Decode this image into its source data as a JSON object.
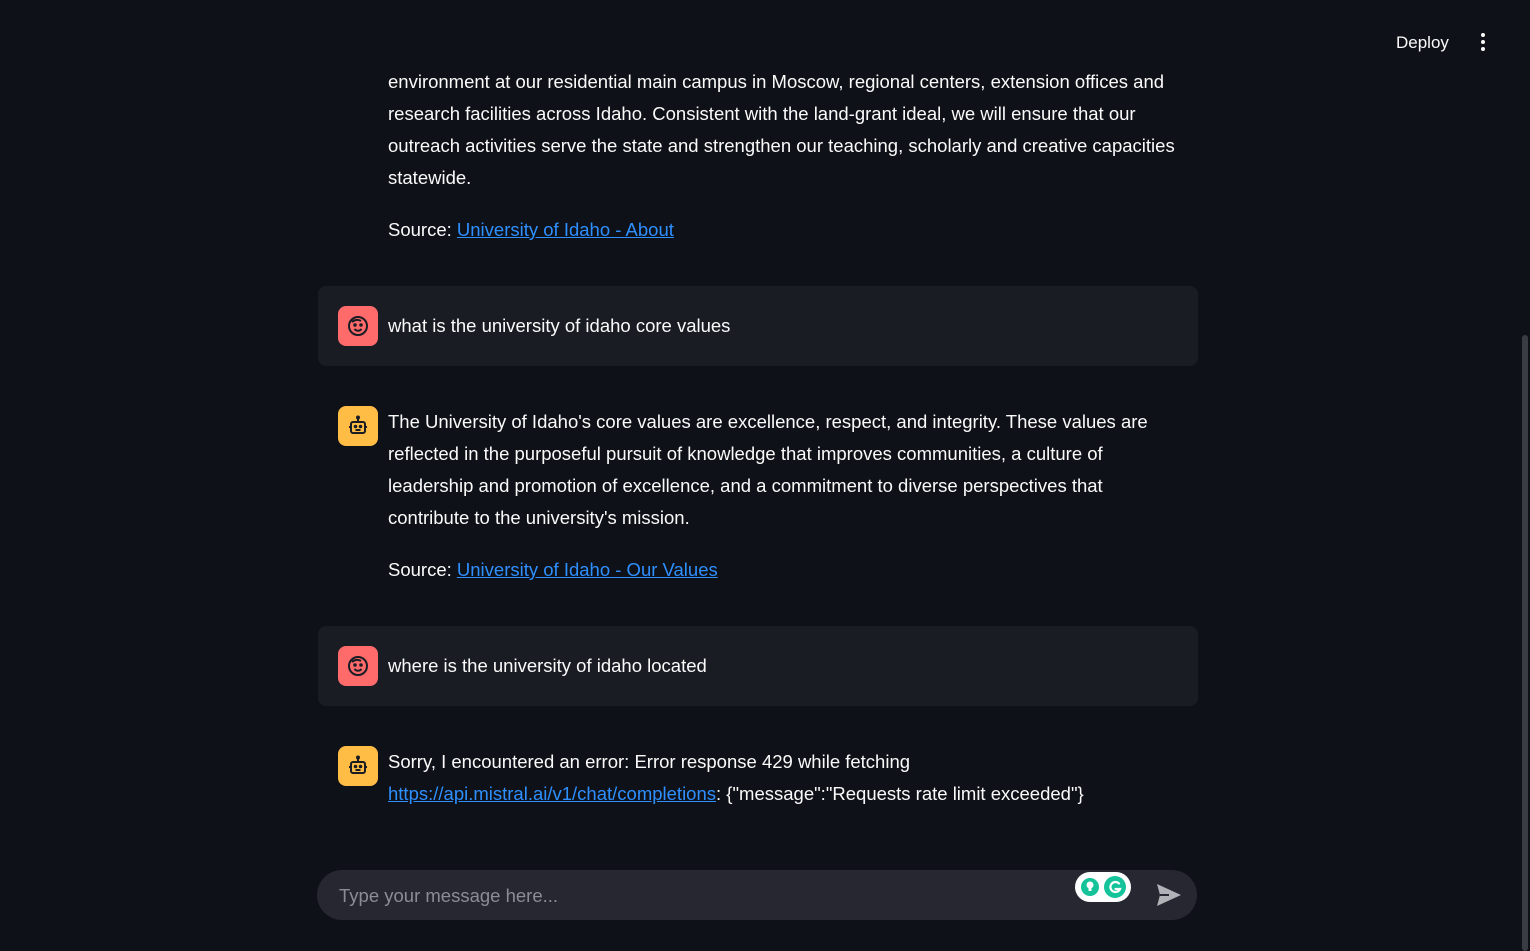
{
  "header": {
    "deploy_label": "Deploy"
  },
  "messages": [
    {
      "role": "assistant",
      "paragraphs": [
        "environment at our residential main campus in Moscow, regional centers, extension offices and research facilities across Idaho. Consistent with the land-grant ideal, we will ensure that our outreach activities serve the state and strengthen our teaching, scholarly and creative capacities statewide."
      ],
      "source_prefix": "Source: ",
      "source_link": "University of Idaho - About"
    },
    {
      "role": "user",
      "text": "what is the university of idaho core values"
    },
    {
      "role": "assistant",
      "paragraphs": [
        "The University of Idaho's core values are excellence, respect, and integrity. These values are reflected in the purposeful pursuit of knowledge that improves communities, a culture of leadership and promotion of excellence, and a commitment to diverse perspectives that contribute to the university's mission."
      ],
      "source_prefix": "Source: ",
      "source_link": "University of Idaho - Our Values"
    },
    {
      "role": "user",
      "text": "where is the university of idaho located"
    },
    {
      "role": "assistant",
      "error_prefix": "Sorry, I encountered an error: Error response 429 while fetching",
      "error_link": "https://api.mistral.ai/v1/chat/completions",
      "error_suffix": ": {\"message\":\"Requests rate limit exceeded\"}"
    }
  ],
  "chat_input": {
    "placeholder": "Type your message here..."
  },
  "icons": {
    "user_avatar": "smiling-face-icon",
    "assistant_avatar": "robot-icon",
    "send": "send-arrow-icon",
    "menu": "vertical-dots-icon",
    "grammarly": "grammarly-icon"
  },
  "colors": {
    "background": "#0e1117",
    "user_bubble": "#1a1c24",
    "user_avatar": "#ff6b6b",
    "assistant_avatar": "#ffbd45",
    "link": "#2e8fff",
    "input_bg": "#262730"
  }
}
